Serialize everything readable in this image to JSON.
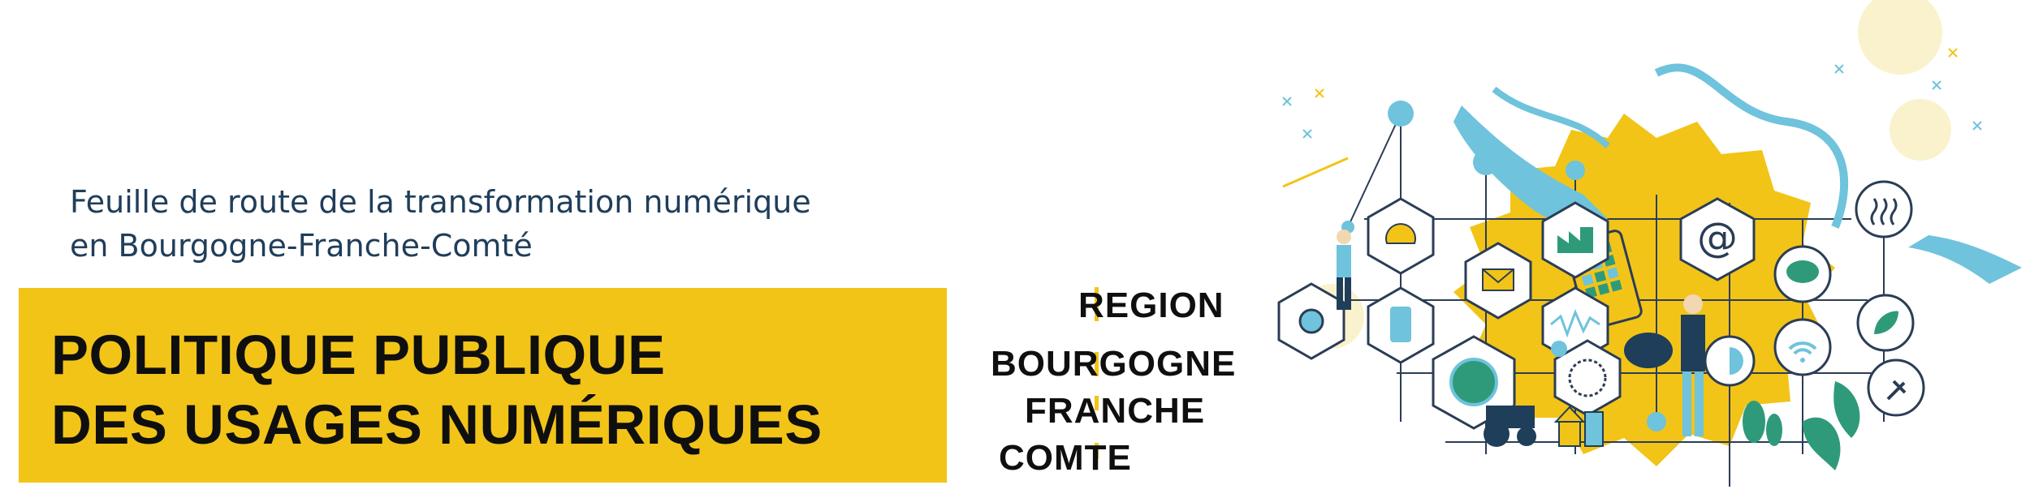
{
  "header": {
    "subtitle_line1": "Feuille de route de la transformation numérique",
    "subtitle_line2": "en Bourgogne-Franche-Comté"
  },
  "banner": {
    "title_line1": "POLITIQUE PUBLIQUE",
    "title_line2": "DES USAGES NUMÉRIQUES"
  },
  "logo": {
    "line1": "REGION",
    "line2": "BOURGOGNE",
    "line3": "FRANCHE",
    "line4": "COMTE"
  },
  "illustration": {
    "at_symbol": "@"
  },
  "colors": {
    "brand_yellow": "#f2c418",
    "accent_blue": "#6fc3dc",
    "dark_navy": "#1f3e5a",
    "leaf_green": "#2f9a7a"
  }
}
